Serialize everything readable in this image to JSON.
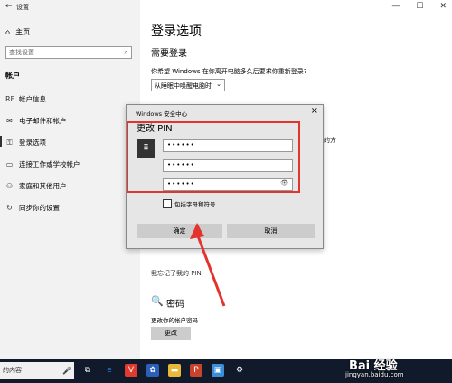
{
  "window": {
    "title": "设置",
    "back": "←",
    "minimize": "—",
    "maximize": "☐",
    "close": "✕"
  },
  "sidebar": {
    "home": "主页",
    "search_placeholder": "查找设置",
    "section": "帐户",
    "items": [
      {
        "label": "帐户信息",
        "icon": "RE"
      },
      {
        "label": "电子邮件和帐户",
        "icon": "✉"
      },
      {
        "label": "登录选项",
        "icon": "⚿"
      },
      {
        "label": "连接工作或学校帐户",
        "icon": "▭"
      },
      {
        "label": "家庭和其他用户",
        "icon": "⚇"
      },
      {
        "label": "同步你的设置",
        "icon": "↻"
      }
    ]
  },
  "main": {
    "title": "登录选项",
    "require_signin": "需要登录",
    "question": "你希望 Windows 在你离开电脑多久后要求你重新登录?",
    "dropdown_value": "从睡眠中唤醒电脑时",
    "partial_text": "的方",
    "forgot_pin": "我忘记了我的 PIN",
    "password_title": "密码",
    "password_sub": "更改你的帐户密码",
    "change_button": "更改"
  },
  "dialog": {
    "title": "Windows 安全中心",
    "heading": "更改 PIN",
    "pins": [
      "••••••",
      "••••••",
      "••••••"
    ],
    "checkbox_label": "包括字母和符号",
    "ok": "确定",
    "cancel": "取消"
  },
  "taskbar": {
    "search_text": "在这里输入你要搜索的内容",
    "search_visible": "的内容"
  },
  "watermark": {
    "logo": "Bai 经验",
    "url": "jingyan.baidu.com"
  },
  "colors": {
    "highlight": "#e2332d",
    "taskbar": "#101a2a"
  }
}
